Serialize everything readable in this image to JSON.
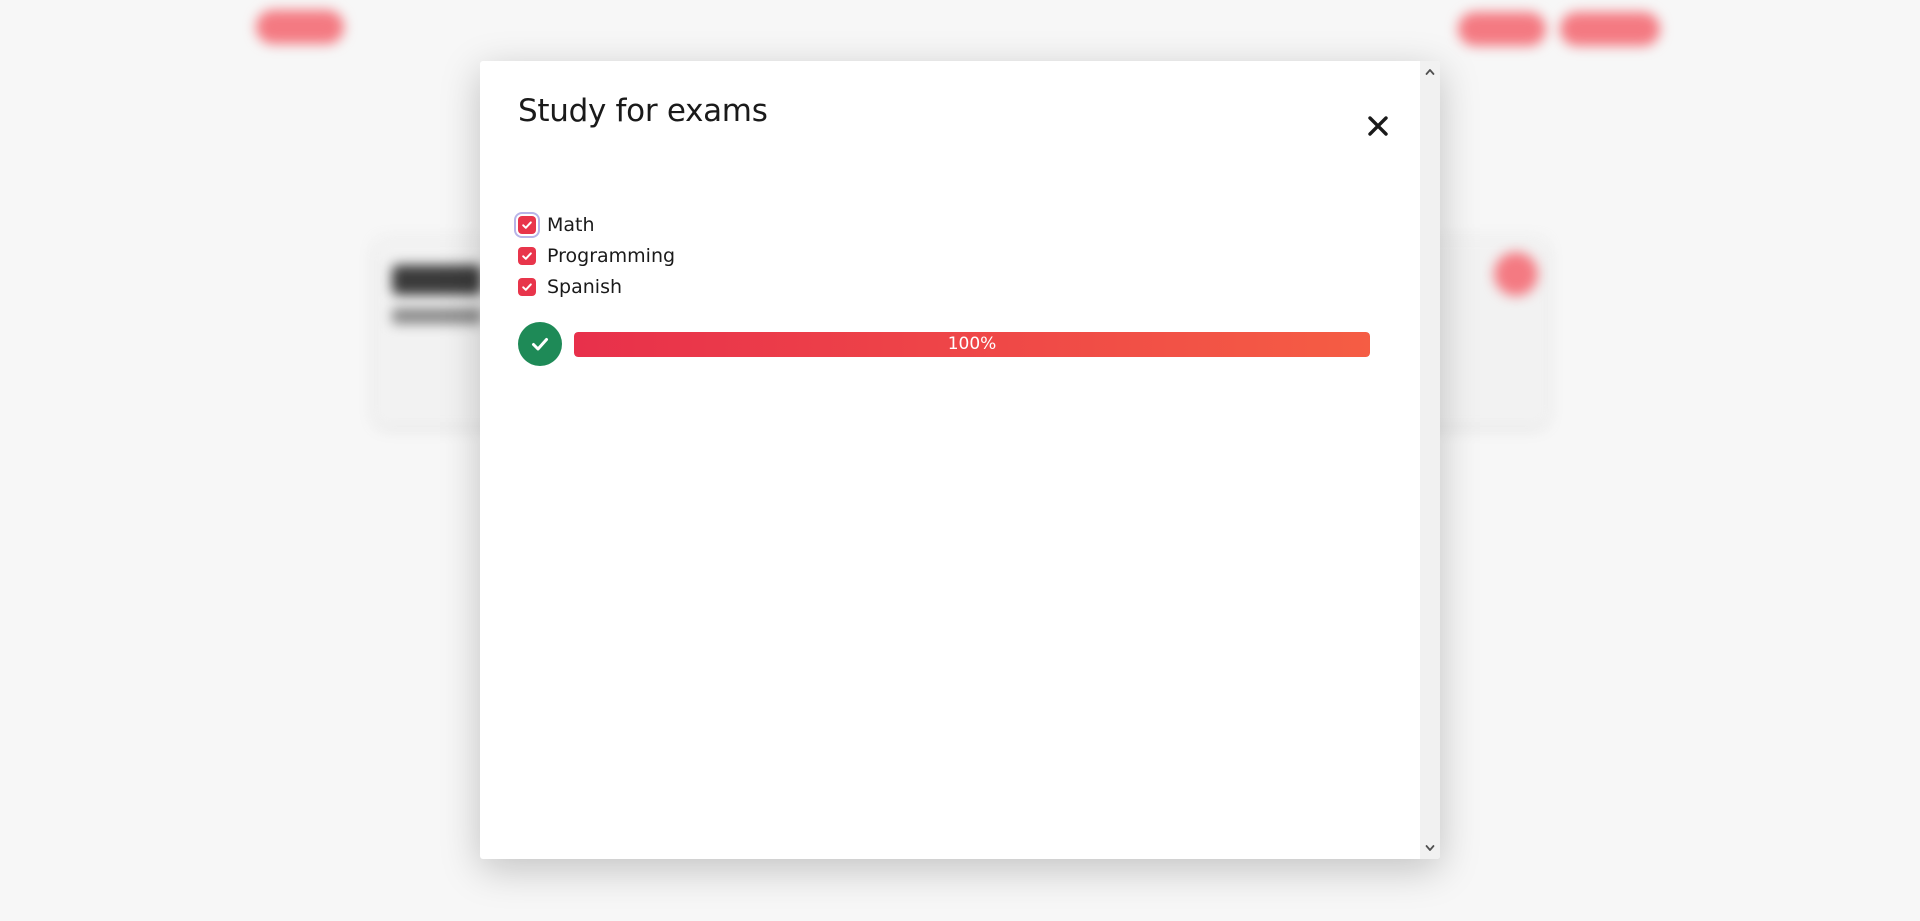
{
  "modal": {
    "title": "Study for exams",
    "close_icon": "close-icon",
    "items": [
      {
        "label": "Math",
        "checked": true
      },
      {
        "label": "Programming",
        "checked": true
      },
      {
        "label": "Spanish",
        "checked": true
      }
    ],
    "progress": {
      "percent": 100,
      "label": "100%",
      "status_icon": "checkmark-circle-icon",
      "status_color": "#1e8a57"
    },
    "scrollbar": {
      "up_icon": "chevron-up-icon",
      "down_icon": "chevron-down-icon"
    }
  },
  "colors": {
    "accent": "#e8354b",
    "gradient_start": "#e8304b",
    "gradient_end": "#f55d44",
    "success": "#1e8a57"
  }
}
